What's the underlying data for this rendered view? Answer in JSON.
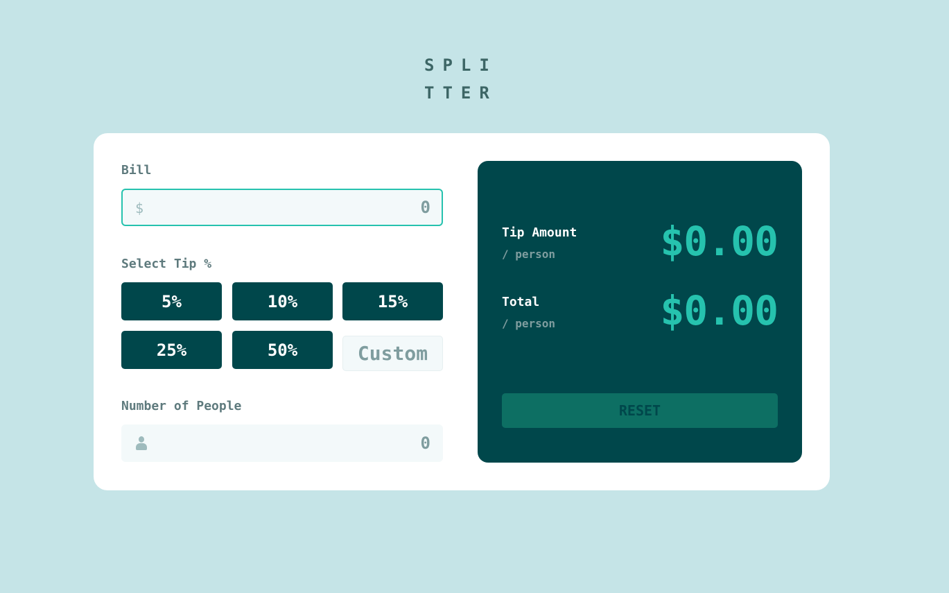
{
  "logo": {
    "line1": "SPLI",
    "line2": "TTER"
  },
  "bill": {
    "label": "Bill",
    "icon": "$",
    "value": "0"
  },
  "tip": {
    "label": "Select Tip %",
    "options": [
      "5%",
      "10%",
      "15%",
      "25%",
      "50%"
    ],
    "custom_placeholder": "Custom"
  },
  "people": {
    "label": "Number of People",
    "value": "0",
    "icon": "person-icon"
  },
  "results": {
    "tip_amount": {
      "title": "Tip Amount",
      "sub": "/ person",
      "value": "$0.00"
    },
    "total": {
      "title": "Total",
      "sub": "/ person",
      "value": "$0.00"
    },
    "reset_label": "RESET"
  },
  "colors": {
    "background": "#c5e4e7",
    "dark_cyan": "#00474b",
    "strong_cyan": "#26c2ae",
    "reset_disabled": "#0d6f63"
  }
}
